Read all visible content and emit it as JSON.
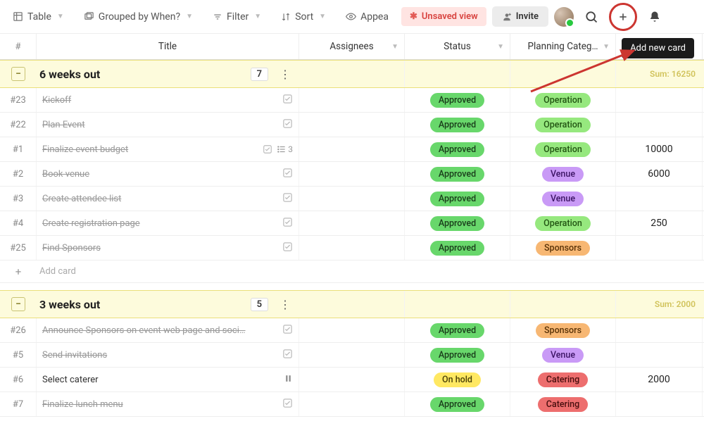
{
  "toolbar": {
    "table_label": "Table",
    "grouped_label": "Grouped by When?",
    "filter_label": "Filter",
    "sort_label": "Sort",
    "appearance_label": "Appea",
    "unsaved_label": "Unsaved view",
    "invite_label": "Invite"
  },
  "tooltip": {
    "add_new_card": "Add new card"
  },
  "columns": {
    "num": "#",
    "title": "Title",
    "assignees": "Assignees",
    "status": "Status",
    "planning": "Planning Categ…"
  },
  "groups": [
    {
      "name": "6 weeks out",
      "count": "7",
      "sum_label": "Sum: 16250",
      "rows": [
        {
          "num": "#23",
          "title": "Kickoff",
          "done": true,
          "status": "Approved",
          "status_class": "approved",
          "cat": "Operation",
          "cat_class": "operation",
          "value": ""
        },
        {
          "num": "#22",
          "title": "Plan Event",
          "done": true,
          "status": "Approved",
          "status_class": "approved",
          "cat": "Operation",
          "cat_class": "operation",
          "value": ""
        },
        {
          "num": "#1",
          "title": "Finalize event budget",
          "done": true,
          "extra_subtasks": "3",
          "status": "Approved",
          "status_class": "approved",
          "cat": "Operation",
          "cat_class": "operation",
          "value": "10000"
        },
        {
          "num": "#2",
          "title": "Book venue",
          "done": true,
          "status": "Approved",
          "status_class": "approved",
          "cat": "Venue",
          "cat_class": "venue",
          "value": "6000"
        },
        {
          "num": "#3",
          "title": "Create attendee list",
          "done": true,
          "status": "Approved",
          "status_class": "approved",
          "cat": "Venue",
          "cat_class": "venue",
          "value": ""
        },
        {
          "num": "#4",
          "title": "Create registration page",
          "done": true,
          "status": "Approved",
          "status_class": "approved",
          "cat": "Operation",
          "cat_class": "operation",
          "value": "250"
        },
        {
          "num": "#25",
          "title": "Find Sponsors",
          "done": true,
          "status": "Approved",
          "status_class": "approved",
          "cat": "Sponsors",
          "cat_class": "sponsors",
          "value": ""
        }
      ],
      "add_label": "Add card"
    },
    {
      "name": "3 weeks out",
      "count": "5",
      "sum_label": "Sum: 2000",
      "rows": [
        {
          "num": "#26",
          "title": "Announce Sponsors on event web page and soci…",
          "done": true,
          "status": "Approved",
          "status_class": "approved",
          "cat": "Sponsors",
          "cat_class": "sponsors",
          "value": ""
        },
        {
          "num": "#5",
          "title": "Send invitations",
          "done": true,
          "status": "Approved",
          "status_class": "approved",
          "cat": "Venue",
          "cat_class": "venue",
          "value": ""
        },
        {
          "num": "#6",
          "title": "Select caterer",
          "done": false,
          "paused": true,
          "status": "On hold",
          "status_class": "onhold",
          "cat": "Catering",
          "cat_class": "catering",
          "value": "2000"
        },
        {
          "num": "#7",
          "title": "Finalize lunch menu",
          "done": true,
          "status": "Approved",
          "status_class": "approved",
          "cat": "Catering",
          "cat_class": "catering",
          "value": ""
        }
      ]
    }
  ]
}
